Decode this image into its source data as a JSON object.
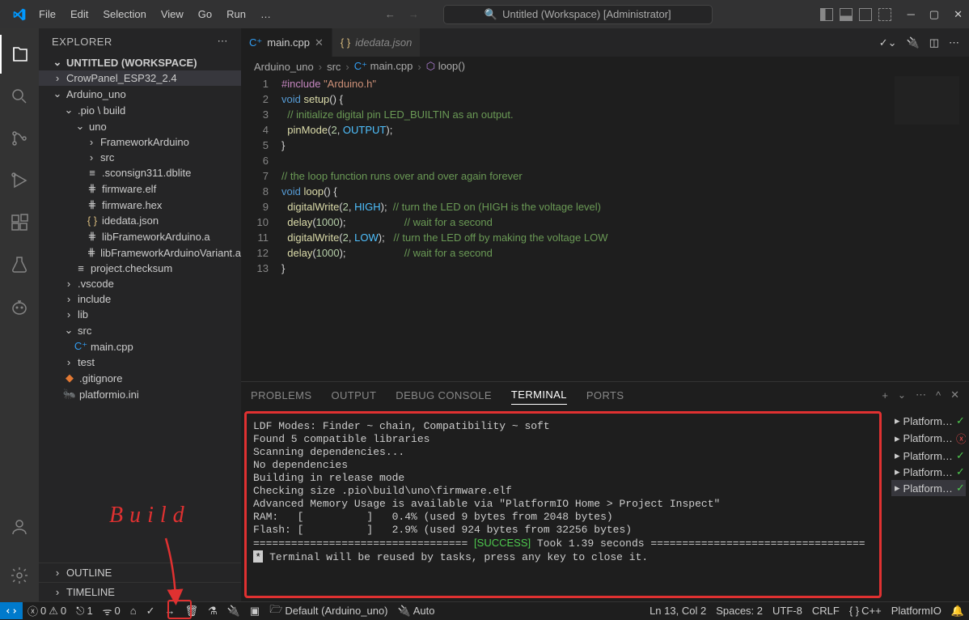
{
  "title_bar": {
    "menus": [
      "File",
      "Edit",
      "Selection",
      "View",
      "Go",
      "Run",
      "…"
    ],
    "search": "Untitled (Workspace) [Administrator]"
  },
  "sidebar": {
    "title": "EXPLORER",
    "workspace": "UNTITLED (WORKSPACE)",
    "tree": [
      {
        "type": "folder",
        "label": "CrowPanel_ESP32_2.4",
        "depth": 0,
        "open": false,
        "selected": true
      },
      {
        "type": "folder",
        "label": "Arduino_uno",
        "depth": 0,
        "open": true
      },
      {
        "type": "folder",
        "label": ".pio \\ build",
        "depth": 1,
        "open": true
      },
      {
        "type": "folder",
        "label": "uno",
        "depth": 2,
        "open": true
      },
      {
        "type": "folder",
        "label": "FrameworkArduino",
        "depth": 3,
        "open": false
      },
      {
        "type": "folder",
        "label": "src",
        "depth": 3,
        "open": false
      },
      {
        "type": "file",
        "label": ".sconsign311.dblite",
        "depth": 3,
        "icon": "lines"
      },
      {
        "type": "file",
        "label": "firmware.elf",
        "depth": 3,
        "icon": "hash"
      },
      {
        "type": "file",
        "label": "firmware.hex",
        "depth": 3,
        "icon": "hash"
      },
      {
        "type": "file",
        "label": "idedata.json",
        "depth": 3,
        "icon": "json",
        "yellow": true
      },
      {
        "type": "file",
        "label": "libFrameworkArduino.a",
        "depth": 3,
        "icon": "hash"
      },
      {
        "type": "file",
        "label": "libFrameworkArduinoVariant.a",
        "depth": 3,
        "icon": "hash"
      },
      {
        "type": "file",
        "label": "project.checksum",
        "depth": 2,
        "icon": "lines"
      },
      {
        "type": "folder",
        "label": ".vscode",
        "depth": 1,
        "open": false
      },
      {
        "type": "folder",
        "label": "include",
        "depth": 1,
        "open": false
      },
      {
        "type": "folder",
        "label": "lib",
        "depth": 1,
        "open": false
      },
      {
        "type": "folder",
        "label": "src",
        "depth": 1,
        "open": true
      },
      {
        "type": "file",
        "label": "main.cpp",
        "depth": 2,
        "icon": "cpp"
      },
      {
        "type": "folder",
        "label": "test",
        "depth": 1,
        "open": false
      },
      {
        "type": "file",
        "label": ".gitignore",
        "depth": 1,
        "icon": "git"
      },
      {
        "type": "file",
        "label": "platformio.ini",
        "depth": 1,
        "icon": "pio"
      }
    ],
    "outline": "OUTLINE",
    "timeline": "TIMELINE"
  },
  "tabs": [
    {
      "label": "main.cpp",
      "icon": "cpp",
      "active": true,
      "close": true
    },
    {
      "label": "idedata.json",
      "icon": "json",
      "active": false,
      "italic": true
    }
  ],
  "breadcrumb": [
    "Arduino_uno",
    "src",
    "main.cpp",
    "loop()"
  ],
  "code_lines": [
    {
      "n": 1,
      "html": "<span class='macro'>#include</span> <span class='str'>\"Arduino.h\"</span>"
    },
    {
      "n": 2,
      "html": "<span class='kw'>void</span> <span class='fn'>setup</span>() {"
    },
    {
      "n": 3,
      "html": "  <span class='cm'>// initialize digital pin LED_BUILTIN as an output.</span>"
    },
    {
      "n": 4,
      "html": "  <span class='fn'>pinMode</span>(<span class='num'>2</span>, <span class='const'>OUTPUT</span>);"
    },
    {
      "n": 5,
      "html": "}"
    },
    {
      "n": 6,
      "html": ""
    },
    {
      "n": 7,
      "html": "<span class='cm'>// the loop function runs over and over again forever</span>"
    },
    {
      "n": 8,
      "html": "<span class='kw'>void</span> <span class='fn'>loop</span>() {"
    },
    {
      "n": 9,
      "html": "  <span class='fn'>digitalWrite</span>(<span class='num'>2</span>, <span class='const'>HIGH</span>);  <span class='cm'>// turn the LED on (HIGH is the voltage level)</span>"
    },
    {
      "n": 10,
      "html": "  <span class='fn'>delay</span>(<span class='num'>1000</span>);                    <span class='cm'>// wait for a second</span>"
    },
    {
      "n": 11,
      "html": "  <span class='fn'>digitalWrite</span>(<span class='num'>2</span>, <span class='const'>LOW</span>);   <span class='cm'>// turn the LED off by making the voltage LOW</span>"
    },
    {
      "n": 12,
      "html": "  <span class='fn'>delay</span>(<span class='num'>1000</span>);                    <span class='cm'>// wait for a second</span>"
    },
    {
      "n": 13,
      "html": "}"
    }
  ],
  "panel": {
    "tabs": [
      "PROBLEMS",
      "OUTPUT",
      "DEBUG CONSOLE",
      "TERMINAL",
      "PORTS"
    ],
    "active_tab": "TERMINAL",
    "terminal_lines": [
      "LDF Modes: Finder ~ chain, Compatibility ~ soft",
      "Found 5 compatible libraries",
      "Scanning dependencies...",
      "No dependencies",
      "Building in release mode",
      "Checking size .pio\\build\\uno\\firmware.elf",
      "Advanced Memory Usage is available via \"PlatformIO Home > Project Inspect\"",
      "RAM:   [          ]   0.4% (used 9 bytes from 2048 bytes)",
      "Flash: [          ]   2.9% (used 924 bytes from 32256 bytes)"
    ],
    "success_line_prefix": "================================== ",
    "success_text": "[SUCCESS]",
    "success_line_suffix": " Took 1.39 seconds ==================================",
    "reuse_line": "Terminal will be reused by tasks, press any key to close it.",
    "term_list": [
      "Platform…",
      "Platform…",
      "Platform…",
      "Platform…",
      "Platform…"
    ],
    "term_list_active": 4,
    "term_error_idx": 1
  },
  "status": {
    "errors": "0",
    "warnings": "0",
    "ports": "1",
    "default": "Default (Arduino_uno)",
    "auto": "Auto",
    "ln": "Ln 13, Col 2",
    "spaces": "Spaces: 2",
    "enc": "UTF-8",
    "eol": "CRLF",
    "lang": "C++",
    "pio": "PlatformIO"
  },
  "annotation": {
    "label": "Build"
  }
}
